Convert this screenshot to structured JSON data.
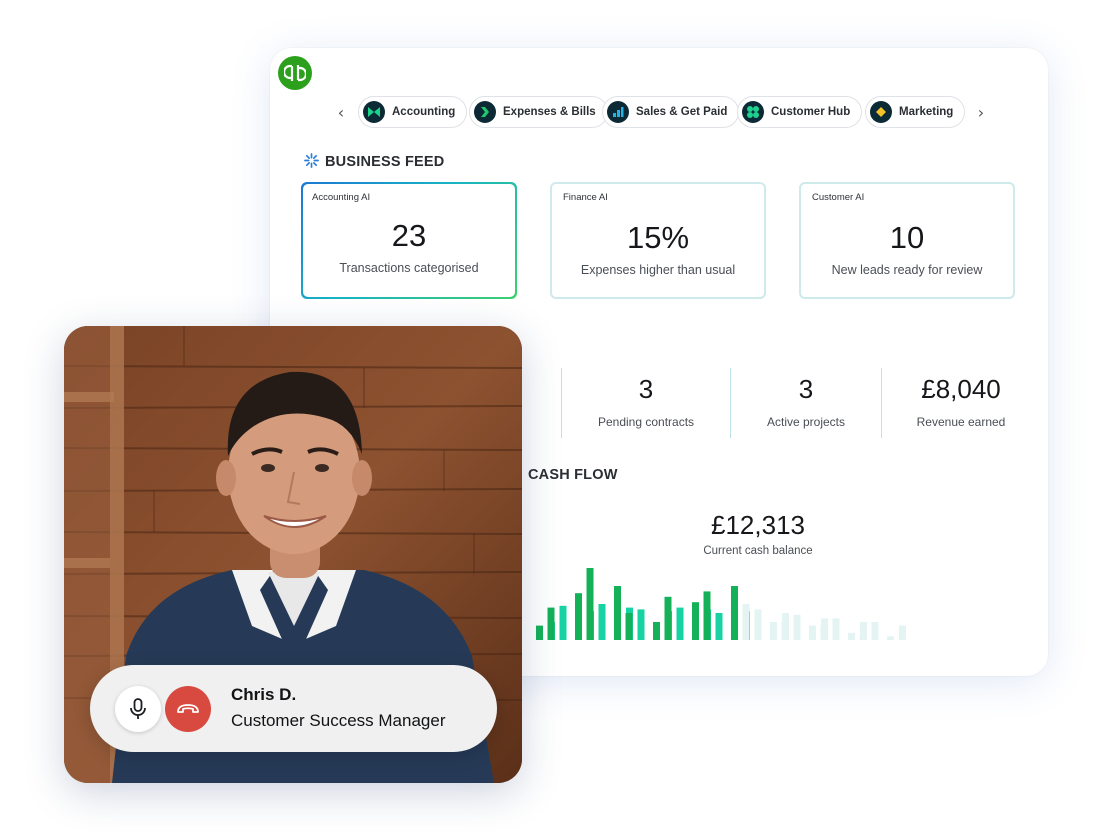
{
  "nav": {
    "prev_icon": "chevron-left-icon",
    "next_icon": "chevron-right-icon",
    "tabs": [
      {
        "label": "Accounting",
        "icon": "accounting-icon"
      },
      {
        "label": "Expenses & Bills",
        "icon": "expenses-icon"
      },
      {
        "label": "Sales & Get Paid",
        "icon": "sales-icon"
      },
      {
        "label": "Customer Hub",
        "icon": "customer-hub-icon"
      },
      {
        "label": "Marketing",
        "icon": "marketing-icon"
      }
    ]
  },
  "business_feed": {
    "title": "BUSINESS FEED",
    "cards": [
      {
        "title": "Accounting AI",
        "value": "23",
        "caption": "Transactions categorised",
        "active": true
      },
      {
        "title": "Finance AI",
        "value": "15%",
        "caption": "Expenses higher than usual",
        "active": false
      },
      {
        "title": "Customer AI",
        "value": "10",
        "caption": "New leads ready for review",
        "active": false
      }
    ]
  },
  "stats": [
    {
      "value": "3",
      "label": "Pending contracts"
    },
    {
      "value": "3",
      "label": "Active projects"
    },
    {
      "value": "£8,040",
      "label": "Revenue earned"
    }
  ],
  "cash_flow": {
    "title": "CASH FLOW",
    "balance": "£12,313",
    "balance_label": "Current cash balance"
  },
  "chart_data": {
    "type": "bar",
    "title": "",
    "series": [
      {
        "color": "#14b158",
        "values": [
          8,
          18,
          26,
          40,
          30,
          15,
          10,
          24,
          21,
          27,
          30,
          20,
          10,
          10,
          8,
          8,
          4,
          2,
          2
        ]
      },
      {
        "color": "#17d3a3",
        "values": [
          10,
          19,
          16,
          20,
          18,
          17,
          16,
          18,
          17,
          15,
          16,
          17,
          15,
          14,
          12,
          12,
          10,
          10,
          8
        ]
      }
    ],
    "colors": {
      "inflow": "#14b158",
      "outflow": "#17d3a3",
      "projected": "#e3f4f3"
    },
    "projected_from_index": 9
  },
  "call": {
    "name": "Chris D.",
    "role": "Customer Success Manager",
    "mic_icon": "microphone-icon",
    "end_icon": "end-call-icon"
  }
}
